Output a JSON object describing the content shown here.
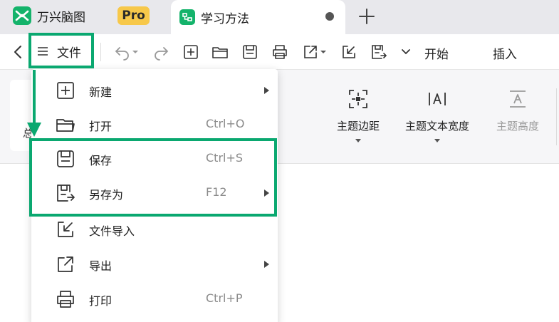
{
  "tabs": {
    "app_name": "万兴脑图",
    "pro_badge": "Pro",
    "doc_title": "学习方法"
  },
  "toolbar": {
    "file_label": "文件",
    "start_label": "开始",
    "insert_label": "插入"
  },
  "ribbon": {
    "partial_label": "总",
    "tools": [
      {
        "label": "主题边距"
      },
      {
        "label": "主题文本宽度"
      },
      {
        "label": "主题高度"
      }
    ]
  },
  "menu": {
    "items": [
      {
        "label": "新建",
        "shortcut": "",
        "icon": "new-icon",
        "submenu": true
      },
      {
        "label": "打开",
        "shortcut": "Ctrl+O",
        "icon": "folder-icon",
        "submenu": false
      },
      {
        "label": "保存",
        "shortcut": "Ctrl+S",
        "icon": "save-icon",
        "submenu": false
      },
      {
        "label": "另存为",
        "shortcut": "F12",
        "icon": "save-as-icon",
        "submenu": true
      },
      {
        "label": "文件导入",
        "shortcut": "",
        "icon": "import-icon",
        "submenu": false
      },
      {
        "label": "导出",
        "shortcut": "",
        "icon": "export-icon",
        "submenu": true
      },
      {
        "label": "打印",
        "shortcut": "Ctrl+P",
        "icon": "print-icon",
        "submenu": false
      }
    ]
  },
  "colors": {
    "highlight": "#0aa870",
    "brand": "#14b36b",
    "pro_badge": "#f7c84a"
  }
}
